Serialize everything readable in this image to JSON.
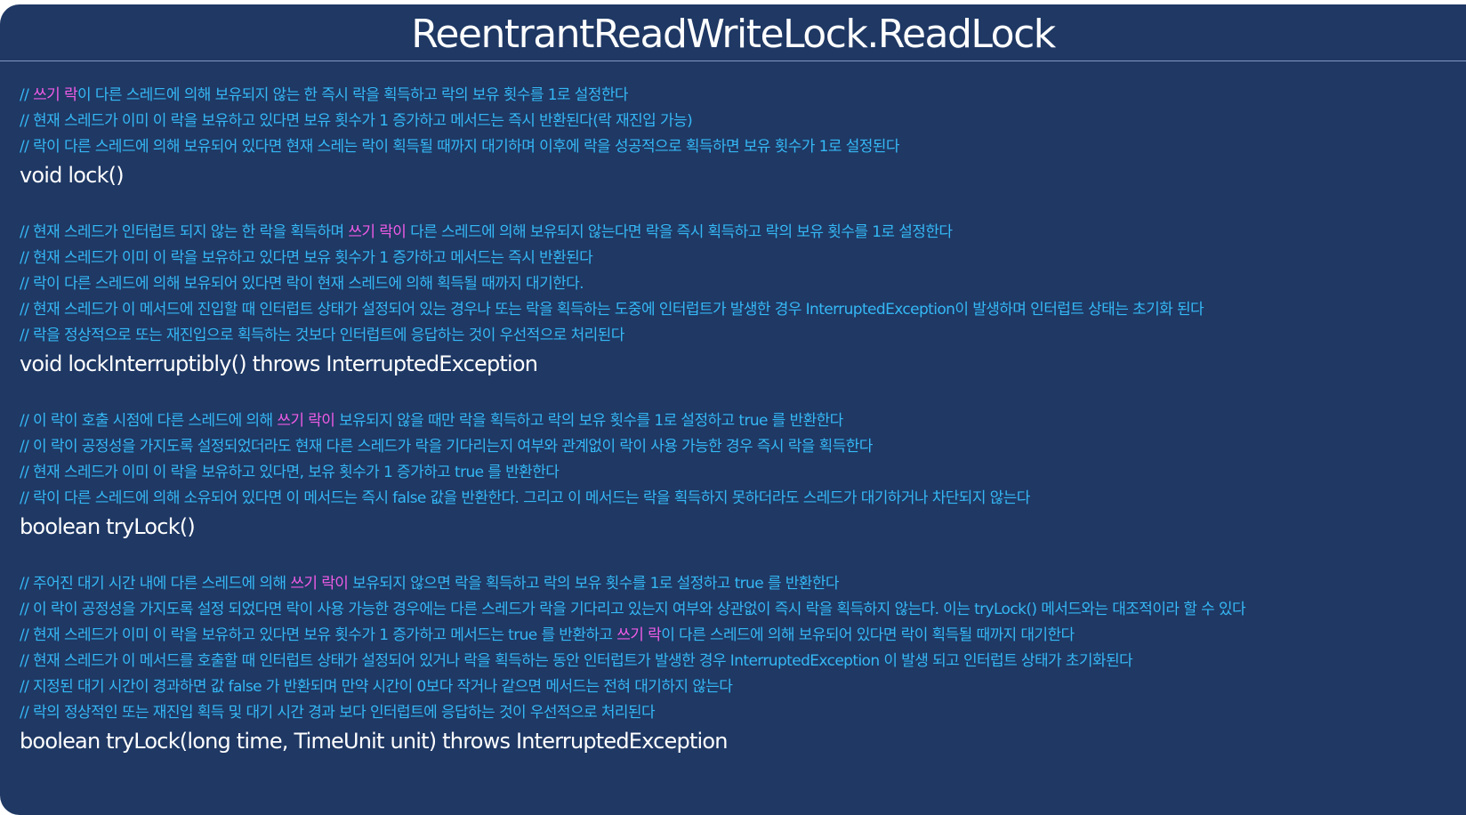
{
  "title": "ReentrantReadWriteLock.ReadLock",
  "colors": {
    "background": "#1f3864",
    "comment": "#35b8f5",
    "highlight": "#f05ce6",
    "signature": "#ffffff"
  },
  "blocks": [
    {
      "comments": [
        {
          "a": "// ",
          "h": "쓰기 락",
          "b": "이 다른 스레드에 의해 보유되지 않는 한 즉시 락을 획득하고 락의 보유 횟수를 1로 설정한다"
        },
        {
          "a": "// 현재 스레드가 이미 이 락을 보유하고 있다면 보유 횟수가 1 증가하고 메서드는 즉시 반환된다(락 재진입 가능)",
          "h": "",
          "b": ""
        },
        {
          "a": "// 락이 다른 스레드에 의해 보유되어 있다면 현재 스레는 락이 획득될 때까지 대기하며 이후에 락을 성공적으로 획득하면 보유 횟수가 1로 설정된다",
          "h": "",
          "b": ""
        }
      ],
      "signature": "void lock()"
    },
    {
      "comments": [
        {
          "a": "// 현재 스레드가 인터럽트 되지 않는 한 락을 획득하며 ",
          "h": "쓰기 락이",
          "b": " 다른 스레드에 의해 보유되지 않는다면 락을 즉시 획득하고 락의 보유 횟수를 1로 설정한다"
        },
        {
          "a": "// 현재 스레드가 이미 이 락을 보유하고 있다면 보유 횟수가 1 증가하고 메서드는 즉시 반환된다",
          "h": "",
          "b": ""
        },
        {
          "a": "// 락이 다른 스레드에 의해 보유되어 있다면 락이 현재 스레드에 의해 획득될 때까지 대기한다.",
          "h": "",
          "b": ""
        },
        {
          "a": "// 현재 스레드가 이 메서드에 진입할 때 인터럽트 상태가 설정되어 있는 경우나 또는 락을 획득하는 도중에 인터럽트가 발생한 경우 InterruptedException이 발생하며 인터럽트 상태는 초기화 된다",
          "h": "",
          "b": ""
        },
        {
          "a": "// 락을 정상적으로 또는 재진입으로 획득하는 것보다 인터럽트에 응답하는 것이 우선적으로 처리된다",
          "h": "",
          "b": ""
        }
      ],
      "signature": "void lockInterruptibly() throws InterruptedException"
    },
    {
      "comments": [
        {
          "a": "// 이 락이 호출 시점에 다른 스레드에 의해 ",
          "h": "쓰기 락이",
          "b": " 보유되지 않을 때만 락을 획득하고 락의 보유 횟수를 1로 설정하고  true 를 반환한다"
        },
        {
          "a": "// 이 락이 공정성을 가지도록 설정되었더라도 현재 다른 스레드가 락을 기다리는지 여부와 관계없이 락이 사용 가능한 경우 즉시 락을 획득한다",
          "h": "",
          "b": ""
        },
        {
          "a": "// 현재 스레드가 이미 이 락을 보유하고 있다면, 보유 횟수가 1 증가하고 true 를 반환한다",
          "h": "",
          "b": ""
        },
        {
          "a": "// 락이 다른 스레드에 의해 소유되어 있다면 이 메서드는 즉시 false 값을 반환한다. 그리고 이 메서드는 락을 획득하지 못하더라도 스레드가 대기하거나 차단되지 않는다",
          "h": "",
          "b": ""
        }
      ],
      "signature": "boolean tryLock()"
    },
    {
      "comments": [
        {
          "a": "// 주어진 대기 시간 내에 다른 스레드에 의해 ",
          "h": "쓰기 락이",
          "b": " 보유되지 않으면 락을 획득하고 락의 보유 횟수를 1로 설정하고 true 를 반환한다"
        },
        {
          "a": "// 이 락이 공정성을 가지도록 설정 되었다면 락이 사용 가능한 경우에는 다른 스레드가 락을 기다리고 있는지 여부와 상관없이 즉시 락을 획득하지 않는다. 이는 tryLock() 메서드와는 대조적이라 할 수 있다",
          "h": "",
          "b": ""
        },
        {
          "a": "// 현재 스레드가 이미 이 락을 보유하고 있다면 보유 횟수가 1 증가하고 메서드는 true 를 반환하고 ",
          "h": "쓰기 락",
          "b": "이 다른 스레드에 의해 보유되어 있다면 락이 획득될 때까지 대기한다"
        },
        {
          "a": "// 현재 스레드가 이 메서드를 호출할 때 인터럽트 상태가 설정되어 있거나 락을 획득하는 동안 인터럽트가 발생한 경우 InterruptedException 이 발생 되고 인터럽트 상태가 초기화된다",
          "h": "",
          "b": ""
        },
        {
          "a": "// 지정된 대기 시간이 경과하면 값 false 가 반환되며 만약 시간이 0보다 작거나 같으면 메서드는 전혀 대기하지 않는다",
          "h": "",
          "b": ""
        },
        {
          "a": "// 락의 정상적인 또는 재진입 획득 및 대기 시간 경과 보다 인터럽트에 응답하는 것이 우선적으로 처리된다",
          "h": "",
          "b": ""
        }
      ],
      "signature": "boolean tryLock(long time, TimeUnit unit) throws InterruptedException"
    }
  ]
}
